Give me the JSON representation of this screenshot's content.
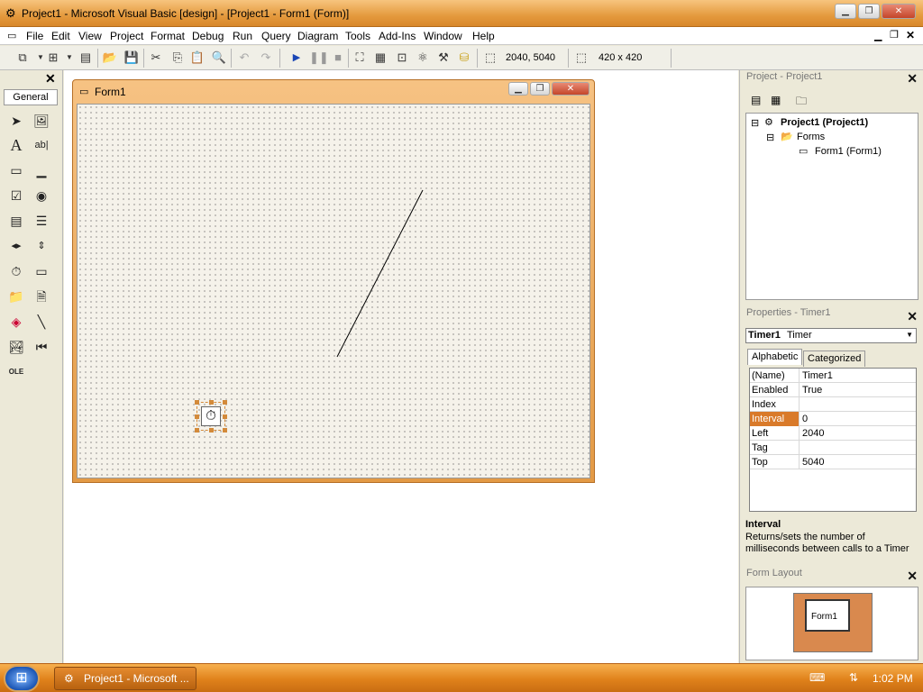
{
  "window": {
    "title": "Project1 - Microsoft Visual Basic [design] - [Project1 - Form1 (Form)]"
  },
  "menu": [
    "File",
    "Edit",
    "View",
    "Project",
    "Format",
    "Debug",
    "Run",
    "Query",
    "Diagram",
    "Tools",
    "Add-Ins",
    "Window",
    "Help"
  ],
  "toolbar": {
    "position_readout": "2040, 5040",
    "size_readout": "420 x 420"
  },
  "toolbox": {
    "label": "General"
  },
  "form": {
    "title": "Form1"
  },
  "project_pane": {
    "title": "Project - Project1",
    "root": "Project1 (Project1)",
    "folder": "Forms",
    "item": "Form1 (Form1)"
  },
  "properties_pane": {
    "title": "Properties - Timer1",
    "object_name": "Timer1",
    "object_type": "Timer",
    "tabs": [
      "Alphabetic",
      "Categorized"
    ],
    "rows": [
      {
        "name": "(Name)",
        "value": "Timer1"
      },
      {
        "name": "Enabled",
        "value": "True"
      },
      {
        "name": "Index",
        "value": ""
      },
      {
        "name": "Interval",
        "value": "0"
      },
      {
        "name": "Left",
        "value": "2040"
      },
      {
        "name": "Tag",
        "value": ""
      },
      {
        "name": "Top",
        "value": "5040"
      }
    ],
    "selected_row": "Interval",
    "desc_title": "Interval",
    "desc_text": "Returns/sets the number of milliseconds between calls to a Timer"
  },
  "form_layout": {
    "title": "Form Layout",
    "preview_label": "Form1"
  },
  "taskbar": {
    "button_label": "Project1 - Microsoft ...",
    "clock": "1:02 PM"
  },
  "colors": {
    "accent": "#e39a45",
    "selection": "#d97a2a"
  }
}
